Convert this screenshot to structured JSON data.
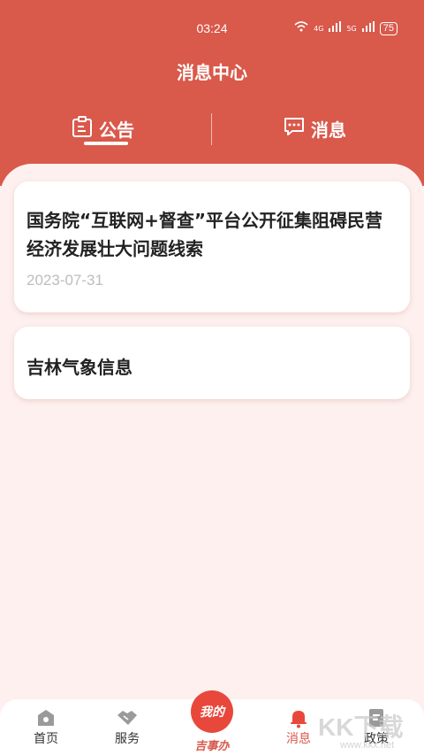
{
  "status": {
    "time": "03:24",
    "signal1": "4G",
    "signal2": "5G",
    "battery": "75"
  },
  "header": {
    "title": "消息中心"
  },
  "tabs": [
    {
      "label": "公告",
      "icon": "notice-icon",
      "active": true
    },
    {
      "label": "消息",
      "icon": "chat-icon",
      "active": false
    }
  ],
  "cards": [
    {
      "title": "国务院“互联网+督查”平台公开征集阻碍民营经济发展壮大问题线索",
      "date": "2023-07-31"
    },
    {
      "title": "吉林气象信息"
    }
  ],
  "nav": {
    "home": "首页",
    "service": "服务",
    "center_btn": "我的",
    "center_label": "吉事办",
    "message": "消息",
    "policy": "政策"
  },
  "watermark": {
    "main": "KK下载",
    "sub": "www.kkx.net"
  },
  "colors": {
    "accent": "#d9594b",
    "background": "#fdf0ef"
  }
}
